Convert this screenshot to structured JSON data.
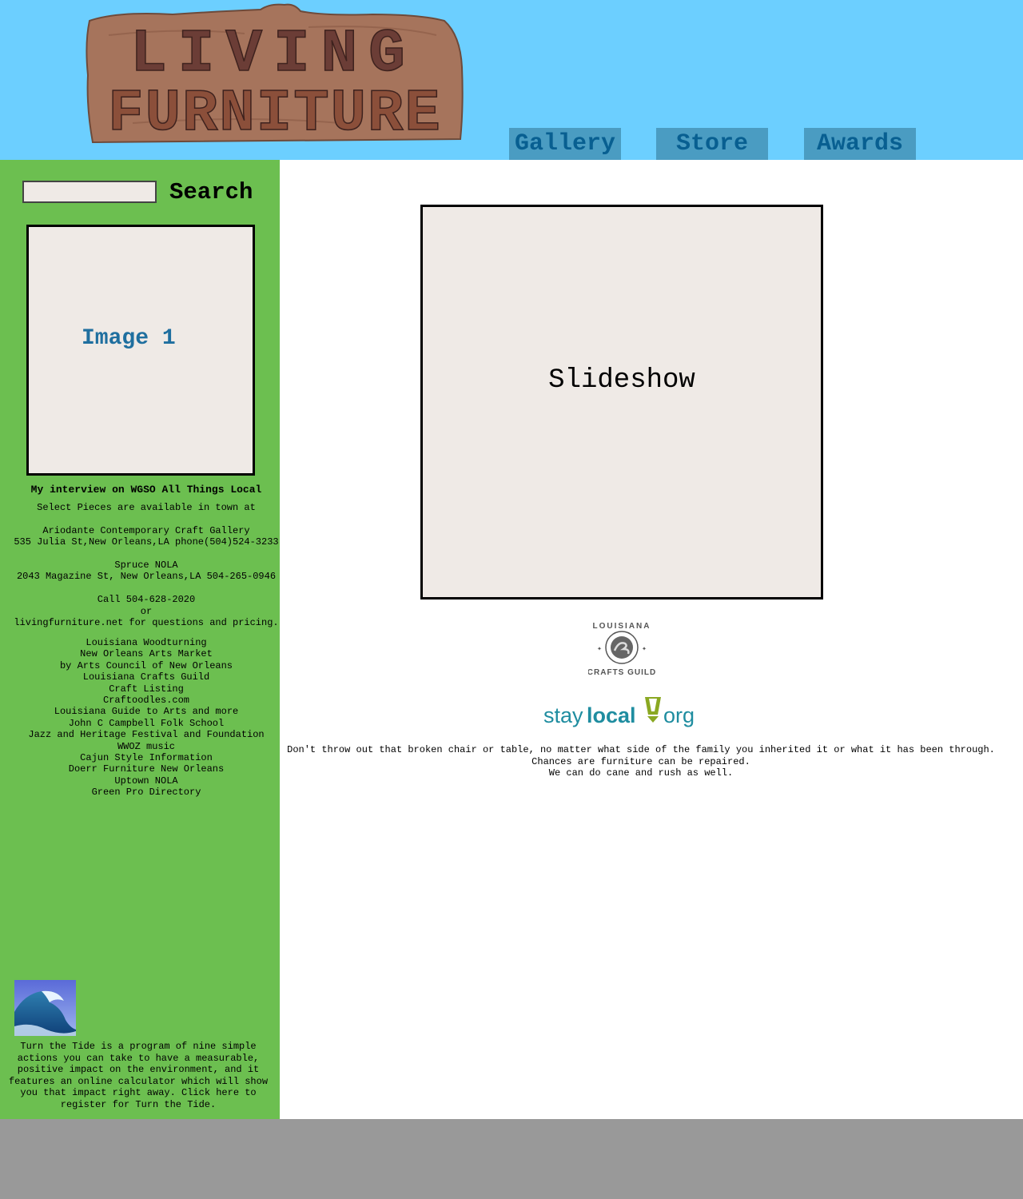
{
  "header": {
    "logo_alt": "Living Furniture",
    "logo_text_line1": "LIVING",
    "logo_text_line2": "FURNITURE",
    "nav": [
      {
        "label": "Gallery"
      },
      {
        "label": "Store"
      },
      {
        "label": "Awards"
      }
    ]
  },
  "sidebar": {
    "search_label": "Search",
    "search_value": "",
    "image_label": "Image 1",
    "interview_link": "My interview on WGSO All Things Local",
    "info_lines": [
      "Select Pieces are available in town at",
      "",
      "Ariodante Contemporary Craft Gallery",
      "535 Julia St,New Orleans,LA phone(504)524-3233",
      "",
      "Spruce NOLA",
      "2043 Magazine St, New Orleans,LA 504-265-0946",
      "",
      "Call 504-628-2020",
      "or",
      "livingfurniture.net for questions and pricing."
    ],
    "links": [
      "Louisiana Woodturning",
      "New Orleans Arts Market",
      "by Arts Council of New Orleans",
      "Louisiana Crafts Guild",
      "Craft Listing",
      "Craftoodles.com",
      "Louisiana Guide to Arts and more",
      "John C Campbell Folk School",
      "Jazz and Heritage Festival and Foundation",
      "WWOZ music",
      "Cajun Style Information",
      "Doerr Furniture New Orleans",
      "Uptown NOLA",
      "Green Pro Directory"
    ],
    "tide_text": "Turn the Tide is a program of nine simple actions you can take to have a measurable, positive impact on the environment, and it features an online calculator which will show you that impact right away. Click here to register for Turn the Tide."
  },
  "main": {
    "slideshow_label": "Slideshow",
    "guild_logo": {
      "top": "LOUISIANA",
      "bottom": "CRAFTS GUILD"
    },
    "staylocal": {
      "part1": "stay",
      "part2": "local",
      "part3": "org"
    },
    "repair_lines": [
      "Don't throw out that broken chair or table, no matter what side of the family you inherited it or what it has been through.",
      "Chances are furniture can be repaired.",
      "We can do cane and rush as well."
    ]
  },
  "colors": {
    "header_bg": "#6ccfff",
    "sidebar_bg": "#6cbf50",
    "nav_bg": "#4a9cc2",
    "nav_text": "#085f91",
    "footer_bg": "#999999"
  }
}
